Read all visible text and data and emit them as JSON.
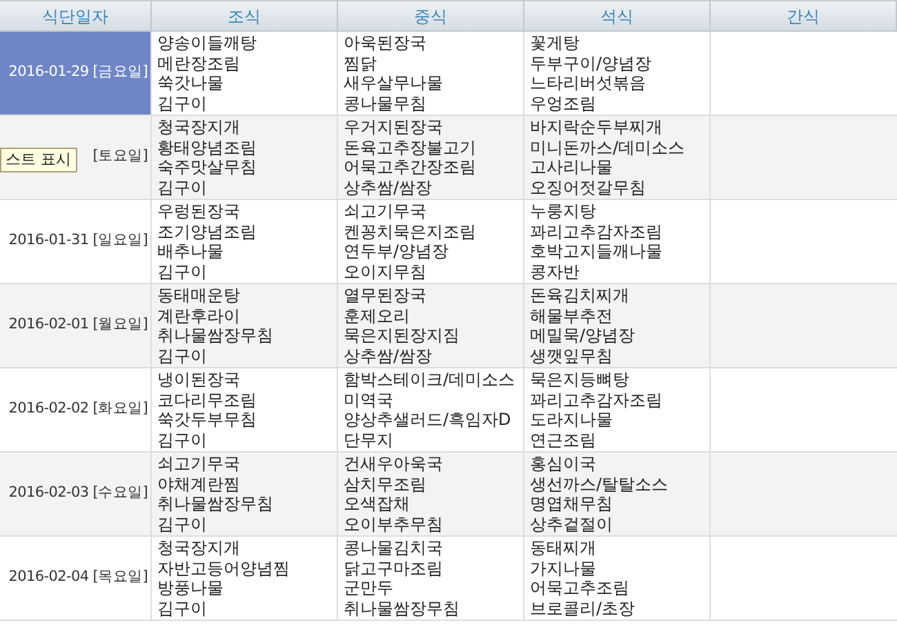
{
  "table": {
    "columns": [
      "식단일자",
      "조식",
      "중식",
      "석식",
      "간식"
    ],
    "rows": [
      {
        "date": "2016-01-29 [금요일]",
        "selected": true,
        "breakfast": [
          "양송이들깨탕",
          "메란장조림",
          "쑥갓나물",
          "김구이"
        ],
        "lunch": [
          "아욱된장국",
          "찜닭",
          "새우살무나물",
          "콩나물무침"
        ],
        "dinner": [
          "꽃게탕",
          "두부구이/양념장",
          "느타리버섯볶음",
          "우엉조림"
        ]
      },
      {
        "date": "[토요일]",
        "selected": false,
        "breakfast": [
          "청국장지개",
          "황태양념조림",
          "숙주맛살무침",
          "김구이"
        ],
        "lunch": [
          "우거지된장국",
          "돈육고추장불고기",
          "어묵고추간장조림",
          "상추쌈/쌈장"
        ],
        "dinner": [
          "바지락순두부찌개",
          "미니돈까스/데미소스",
          "고사리나물",
          "오징어젓갈무침"
        ]
      },
      {
        "date": "2016-01-31 [일요일]",
        "selected": false,
        "breakfast": [
          "우렁된장국",
          "조기양념조림",
          "배추나물",
          "김구이"
        ],
        "lunch": [
          "쇠고기무국",
          "켄꽁치묵은지조림",
          "연두부/양념장",
          "오이지무침"
        ],
        "dinner": [
          "누룽지탕",
          "꽈리고추감자조림",
          "호박고지들깨나물",
          "콩자반"
        ]
      },
      {
        "date": "2016-02-01 [월요일]",
        "selected": false,
        "breakfast": [
          "동태매운탕",
          "계란후라이",
          "취나물쌈장무침",
          "김구이"
        ],
        "lunch": [
          "열무된장국",
          "훈제오리",
          "묵은지된장지짐",
          "상추쌈/쌈장"
        ],
        "dinner": [
          "돈육김치찌개",
          "해물부추전",
          "메밀묵/양념장",
          "생깻잎무침"
        ]
      },
      {
        "date": "2016-02-02 [화요일]",
        "selected": false,
        "breakfast": [
          "냉이된장국",
          "코다리무조림",
          "쑥갓두부무침",
          "김구이"
        ],
        "lunch": [
          "함박스테이크/데미소스",
          "미역국",
          "양상추샐러드/흑임자D",
          "단무지"
        ],
        "dinner": [
          "묵은지등뼈탕",
          "꽈리고추감자조림",
          "도라지나물",
          "연근조림"
        ]
      },
      {
        "date": "2016-02-03 [수요일]",
        "selected": false,
        "breakfast": [
          "쇠고기무국",
          "야채계란찜",
          "취나물쌈장무침",
          "김구이"
        ],
        "lunch": [
          "건새우아욱국",
          "삼치무조림",
          "오색잡채",
          "오이부추무침"
        ],
        "dinner": [
          "홍심이국",
          "생선까스/탈탈소스",
          "명엽채무침",
          "상추겉절이"
        ]
      },
      {
        "date": "2016-02-04 [목요일]",
        "selected": false,
        "breakfast": [
          "청국장지개",
          "자반고등어양념찜",
          "방풍나물",
          "김구이"
        ],
        "lunch": [
          "콩나물김치국",
          "닭고구마조림",
          "군만두",
          "취나물쌈장무침"
        ],
        "dinner": [
          "동태찌개",
          "가지나물",
          "어묵고추조림",
          "브로콜리/초장"
        ]
      }
    ]
  },
  "tooltip": {
    "text": "스트 표시"
  }
}
